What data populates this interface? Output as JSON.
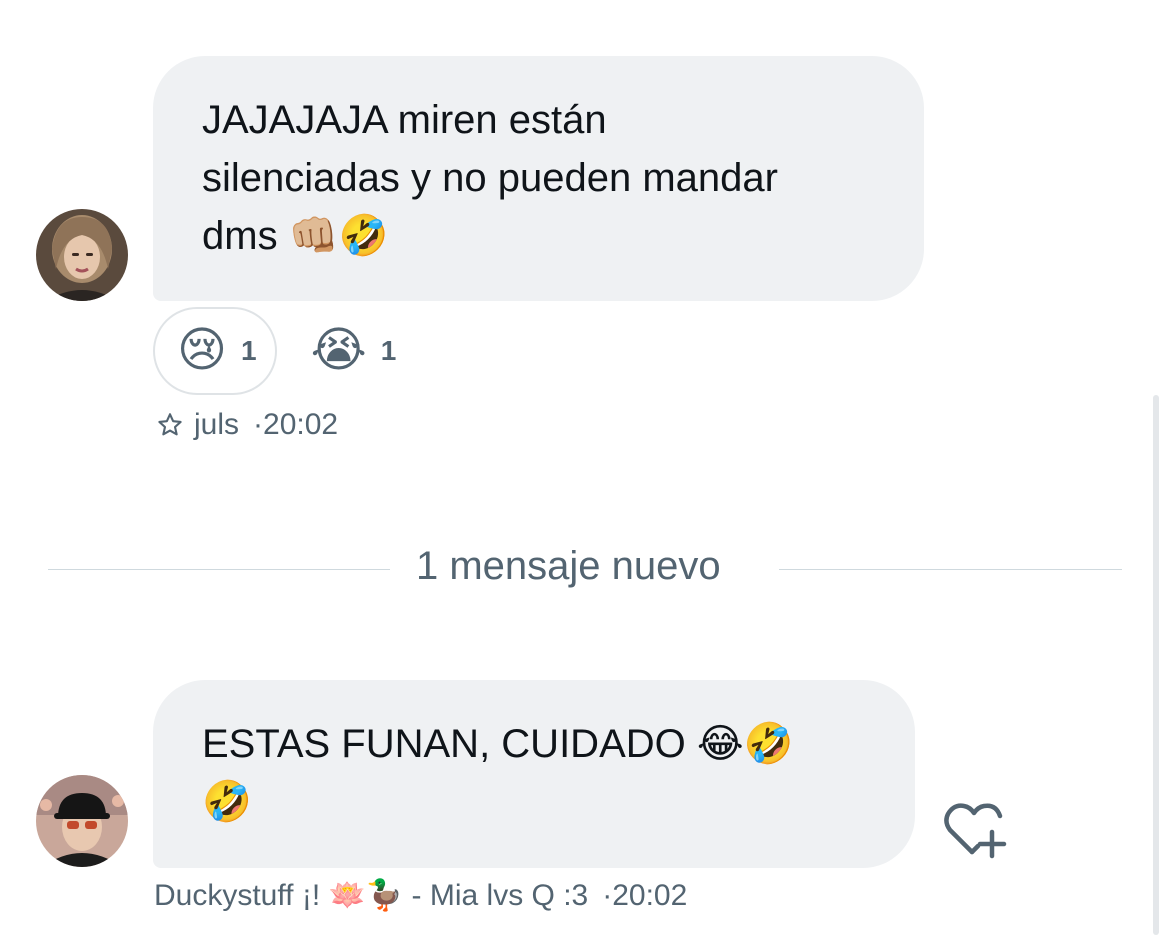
{
  "messages": [
    {
      "text_line1": "JAJAJAJA miren están",
      "text_line2": "silenciadas y no pueden mandar",
      "text_line3": "dms",
      "emojis": "👊🏼🤣",
      "reactions": [
        {
          "emoji": "😢",
          "count": "1",
          "selected": true
        },
        {
          "emoji": "😭",
          "count": "1",
          "selected": false
        }
      ],
      "sender": "juls",
      "time": "·20:02",
      "sender_icon": "star-outline-icon"
    },
    {
      "text_line1": "ESTAS FUNAN, CUIDADO",
      "emojis_line1": "😂🤣",
      "emojis_line2": "🤣",
      "sender": "Duckystuff ¡! 🪷🦆 - Mia lvs Q :3",
      "time": "·20:02"
    }
  ],
  "divider": {
    "label": "1 mensaje nuevo"
  },
  "colors": {
    "bubble": "#eff1f3",
    "meta_text": "#536471",
    "divider": "#cfd9de"
  },
  "icons": {
    "react": "heart-plus-icon"
  }
}
